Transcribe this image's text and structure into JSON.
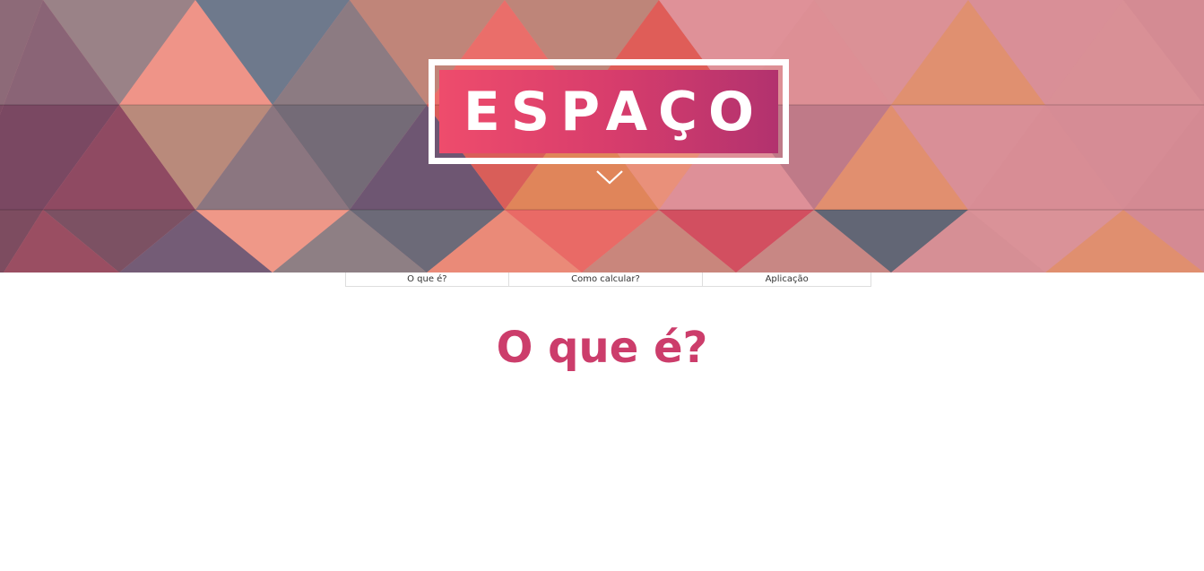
{
  "hero": {
    "title": "ESPAÇO",
    "scroll_icon": "chevron-down-icon",
    "colors": {
      "gradient_start": "#ee4c6c",
      "gradient_end": "#b2326e"
    }
  },
  "nav": {
    "items": [
      {
        "label": "O que é?"
      },
      {
        "label": "Como calcular?"
      },
      {
        "label": "Aplicação"
      }
    ]
  },
  "section": {
    "title": "O que é?",
    "title_color": "#cc3d6b"
  }
}
